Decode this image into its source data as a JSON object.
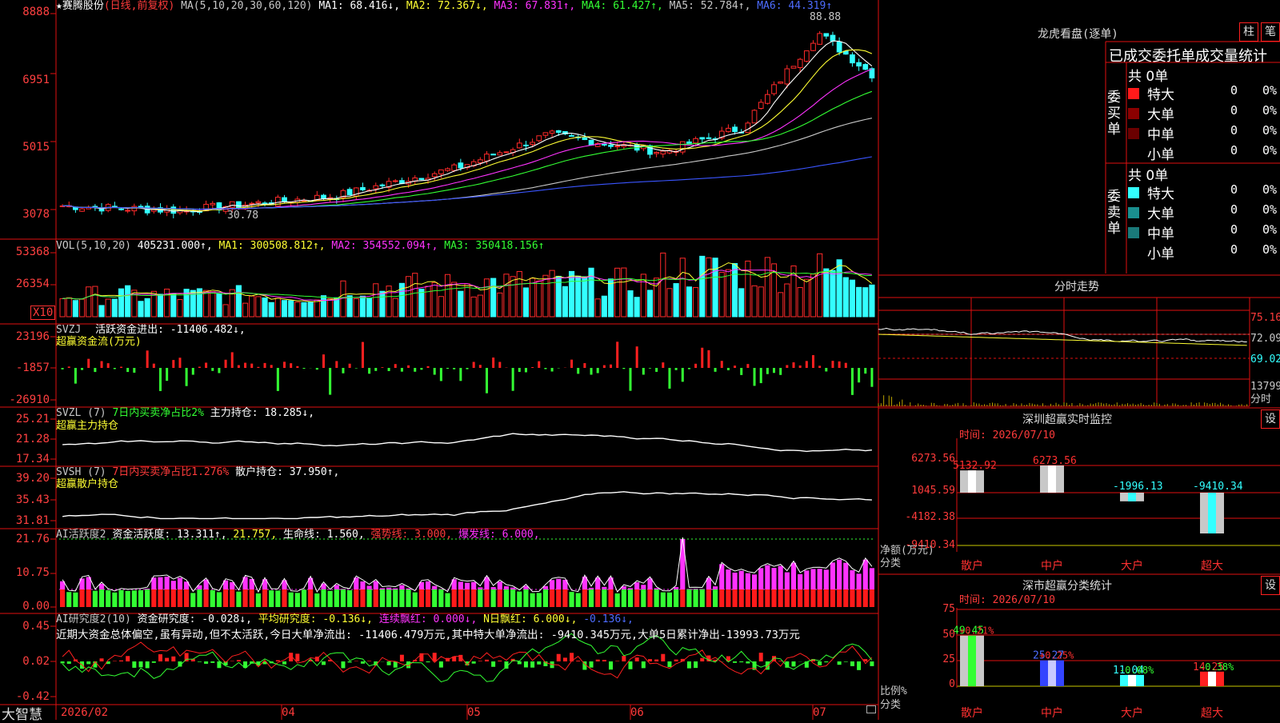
{
  "stock": {
    "name": "★赛腾股份",
    "period": "(日线,前复权)"
  },
  "ma_line": {
    "label": "MA(5,10,20,30,60,120)",
    "ma1": "MA1: 68.416↓,",
    "ma2": "MA2: 72.367↓,",
    "ma3": "MA3: 67.831↑,",
    "ma4": "MA4: 61.427↑,",
    "ma5": "MA5: 52.784↑,",
    "ma6": "MA6: 44.319↑"
  },
  "main_axis": [
    "8888",
    "6951",
    "5015",
    "3078"
  ],
  "annotations": {
    "high": "88.88",
    "low": "30.78"
  },
  "vol": {
    "label": "VOL(5,10,20)",
    "value": "405231.000↑,",
    "ma1": "MA1: 300508.812↑,",
    "ma2": "MA2: 354552.094↑,",
    "ma3": "MA3: 350418.156↑",
    "axis": [
      "53368",
      "26354"
    ],
    "unit": "X10"
  },
  "svzj": {
    "label": "SVZJ",
    "text": "活跃资金进出: -11406.482↓,",
    "sub": "超赢资金流(万元)",
    "axis": [
      "23196",
      "-1857",
      "-26910"
    ]
  },
  "svzl": {
    "label": "SVZL (7)",
    "text1": "7日内买卖净占比2%",
    "text2": "主力持仓: 18.285↓,",
    "sub": "超赢主力持仓",
    "axis": [
      "25.21",
      "21.28",
      "17.34"
    ]
  },
  "svsh": {
    "label": "SVSH (7)",
    "text1": "7日内买卖净占比1.276%",
    "text2": "散户持仓: 37.950↑,",
    "sub": "超赢散户持仓",
    "axis": [
      "39.20",
      "35.43",
      "31.81"
    ]
  },
  "ai2": {
    "label": "AI活跃度2",
    "t1": "资金活跃度: 13.311↑,",
    "t2": "21.757,",
    "t3": "生命线: 1.560,",
    "t4": "强势线: 3.000,",
    "t5": "爆发线: 6.000,",
    "axis": [
      "21.76",
      "10.75",
      "0.00"
    ]
  },
  "ai_research": {
    "label": "AI研究度2(10)",
    "t1": "资金研究度: -0.028↓,",
    "t2": "平均研究度: -0.136↓,",
    "t3": "连续飘红: 0.000↓,",
    "t4": "N日飘红: 6.000↓,",
    "t5": "-0.136↓,",
    "desc": "近期大资金总体偏空,虽有异动,但不太活跃,今日大单净流出: -11406.479万元,其中特大单净流出: -9410.345万元,大单5日累计净出-13993.73万元",
    "axis": [
      "0.45",
      "0.02",
      "-0.42"
    ]
  },
  "bottom": {
    "brand": "大智慧",
    "dates": [
      "2026/02",
      "04",
      "05",
      "06",
      "07"
    ]
  },
  "dragon": {
    "title": "龙虎看盘(逐单)",
    "btn1": "柱",
    "btn2": "笔",
    "header": "已成交委托单成交量统计",
    "buy_label": "委买单",
    "sell_label": "委卖单",
    "buy_total": "共 0单",
    "sell_total": "共 0单",
    "buy_rows": [
      {
        "name": "特大",
        "count": "0",
        "pct": "0%",
        "color": "#ff1a1a"
      },
      {
        "name": "大单",
        "count": "0",
        "pct": "0%",
        "color": "#8b0000"
      },
      {
        "name": "中单",
        "count": "0",
        "pct": "0%",
        "color": "#6b0000"
      },
      {
        "name": "小单",
        "count": "0",
        "pct": "0%",
        "color": ""
      }
    ],
    "sell_rows": [
      {
        "name": "特大",
        "count": "0",
        "pct": "0%",
        "color": "#33ffff"
      },
      {
        "name": "大单",
        "count": "0",
        "pct": "0%",
        "color": "#1a8f8f"
      },
      {
        "name": "中单",
        "count": "0",
        "pct": "0%",
        "color": "#1a7a7a"
      },
      {
        "name": "小单",
        "count": "0",
        "pct": "0%",
        "color": ""
      }
    ]
  },
  "timeshare": {
    "title": "分时走势",
    "axis": [
      "75.16",
      "72.09",
      "69.02",
      "13799"
    ],
    "tag": "分时"
  },
  "sz_monitor": {
    "title": "深圳超赢实时监控",
    "btn": "设",
    "time": "时间: 2026/07/10",
    "axis": [
      "6273.56",
      "1045.59",
      "-4182.38",
      "-9410.34"
    ],
    "ylabel": "净额(万元)",
    "xlabel": "分类",
    "categories": [
      "散户",
      "中户",
      "大户",
      "超大"
    ],
    "values": [
      5132.92,
      6273.56,
      -1996.13,
      -9410.34
    ],
    "value_labels": [
      "5132.92",
      "6273.56",
      "-1996.13",
      "-9410.34"
    ]
  },
  "sz_class": {
    "title": "深市超赢分类统计",
    "btn": "设",
    "time": "时间: 2026/07/10",
    "axis": [
      "75",
      "50",
      "25",
      "0"
    ],
    "ylabel": "比例%",
    "xlabel": "分类",
    "categories": [
      "散户",
      "中户",
      "大户",
      "超大"
    ],
    "values": [
      49.45,
      25.27,
      11.04,
      14.25
    ],
    "value_labels": [
      "49.45",
      "25.27",
      "11.04",
      "14.25"
    ],
    "changes": [
      "+0.21%",
      "+0.25%",
      "-0.08%",
      "-0.38%"
    ]
  },
  "chart_data": [
    {
      "type": "bar",
      "title": "深圳超赢实时监控",
      "categories": [
        "散户",
        "中户",
        "大户",
        "超大"
      ],
      "values": [
        5132.92,
        6273.56,
        -1996.13,
        -9410.34
      ],
      "ylabel": "净额(万元)",
      "xlabel": "分类",
      "ylim": [
        -9410.34,
        6273.56
      ]
    },
    {
      "type": "bar",
      "title": "深市超赢分类统计",
      "categories": [
        "散户",
        "中户",
        "大户",
        "超大"
      ],
      "values": [
        49.45,
        25.27,
        11.04,
        14.25
      ],
      "ylabel": "比例%",
      "xlabel": "分类",
      "ylim": [
        0,
        75
      ]
    }
  ]
}
